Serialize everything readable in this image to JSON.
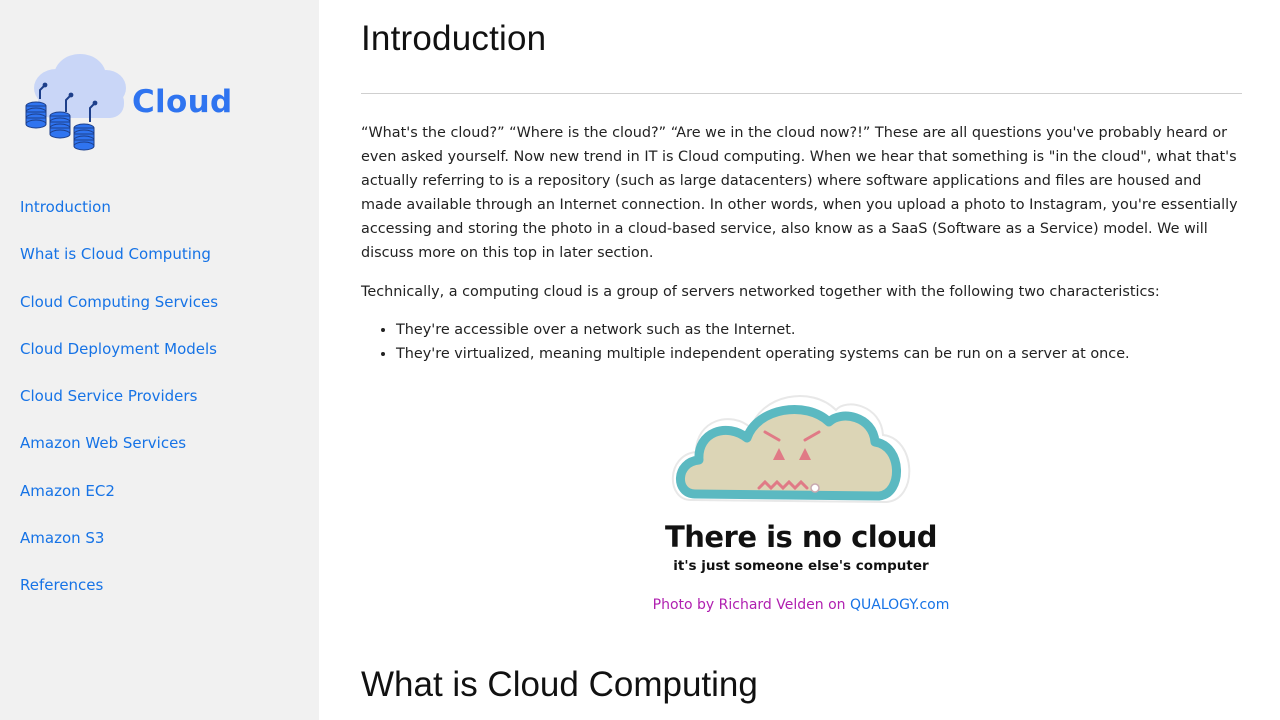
{
  "sidebar": {
    "brand_name": "Cloud",
    "logo_icon": "cloud-database-icon",
    "accent": "#2f74f0",
    "nav": [
      {
        "label": "Introduction"
      },
      {
        "label": "What is Cloud Computing"
      },
      {
        "label": "Cloud Computing Services"
      },
      {
        "label": "Cloud Deployment Models"
      },
      {
        "label": "Cloud Service Providers"
      },
      {
        "label": "Amazon Web Services"
      },
      {
        "label": "Amazon EC2"
      },
      {
        "label": "Amazon S3"
      },
      {
        "label": "References"
      }
    ]
  },
  "main": {
    "title": "Introduction",
    "paragraph1": "“What's the cloud?” “Where is the cloud?” “Are we in the cloud now?!” These are all questions you've probably heard or even asked yourself. Now new trend in IT is Cloud computing. When we hear that something is \"in the cloud\", what that's actually referring to is a repository (such as large datacenters) where software applications and files are housed and made available through an Internet connection. In other words, when you upload a photo to Instagram, you're essentially accessing and storing the photo in a cloud-based service, also know as a SaaS (Software as a Service) model. We will discuss more on this top in later section.",
    "paragraph2": "Technically, a computing cloud is a group of servers networked together with the following two characteristics:",
    "bullets": [
      "They're accessible over a network such as the Internet.",
      "They're virtualized, meaning multiple independent operating systems can be run on a server at once."
    ],
    "figure": {
      "headline": "There is no cloud",
      "subline": "it's just someone else's computer",
      "caption_credit": "Photo by Richard Velden on ",
      "caption_link": "QUALOGY.com"
    },
    "next_title": "What is Cloud Computing"
  }
}
